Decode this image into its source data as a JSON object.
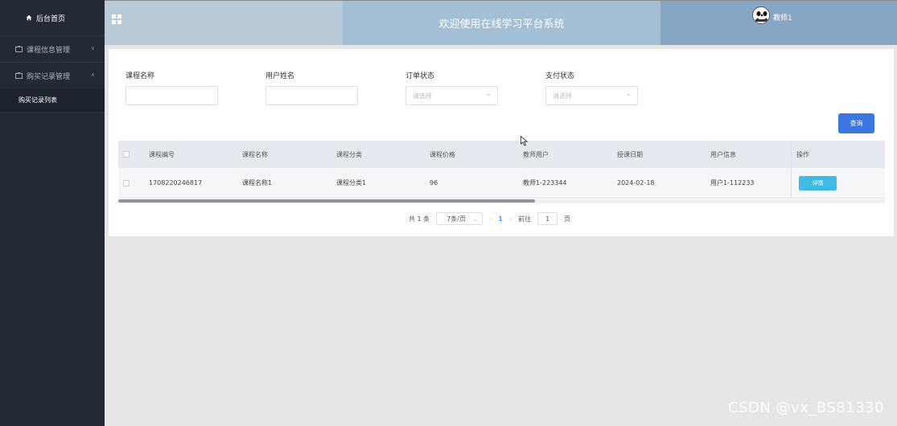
{
  "sidebar": {
    "home_label": "后台首页",
    "groups": [
      {
        "label": "课程信息管理",
        "chevron": "chevron-down"
      },
      {
        "label": "购买记录管理",
        "chevron": "chevron-up"
      }
    ],
    "sub_items": [
      {
        "label": "购买记录列表"
      }
    ]
  },
  "header": {
    "title": "欢迎使用在线学习平台系统",
    "username": "教师1"
  },
  "filters": {
    "course_name": {
      "label": "课程名称",
      "value": ""
    },
    "user_name": {
      "label": "用户姓名",
      "value": ""
    },
    "order_status": {
      "label": "订单状态",
      "placeholder": "请选择"
    },
    "pay_status": {
      "label": "支付状态",
      "placeholder": "请选择"
    }
  },
  "search_label": "查询",
  "table": {
    "headers": [
      "课程编号",
      "课程名称",
      "课程分类",
      "课程价格",
      "教师用户",
      "授课日期",
      "用户信息",
      "操作"
    ],
    "rows": [
      {
        "cells": [
          "1708220246817",
          "课程名称1",
          "课程分类1",
          "96",
          "教师1-223344",
          "2024-02-18",
          "用户1-112233"
        ],
        "action": "详情"
      }
    ]
  },
  "pagination": {
    "total": "共 1 条",
    "page_size": "7条/页",
    "current_page": "1",
    "goto_label": "前往",
    "goto_value": "1",
    "page_suffix": "页"
  },
  "watermark": "CSDN @vx_BS81330",
  "colors": {
    "sidebar_bg": "#232a36",
    "header_left": "#b9cad9",
    "header_mid": "#a3bfd6",
    "header_right": "#87a6c4",
    "primary": "#3c76e0",
    "detail_btn": "#3fbce5"
  }
}
